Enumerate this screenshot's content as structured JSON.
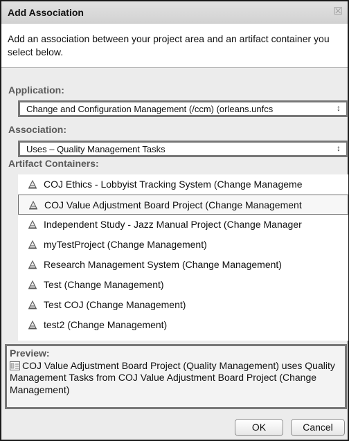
{
  "dialog": {
    "title": "Add Association",
    "close_glyph": "☒",
    "description": "Add an association between your project area and an artifact container you select below."
  },
  "application": {
    "label": "Application:",
    "selected": "Change and Configuration Management (/ccm) (orleans.unfcs"
  },
  "association": {
    "label": "Association:",
    "selected": "Uses – Quality Management Tasks"
  },
  "artifact_containers": {
    "label": "Artifact Containers:",
    "icon": "project-area-icon",
    "items": [
      {
        "label": "COJ Ethics - Lobbyist Tracking System (Change Manageme"
      },
      {
        "label": "COJ Value Adjustment Board Project (Change Management"
      },
      {
        "label": "Independent Study - Jazz Manual Project (Change Manager"
      },
      {
        "label": "myTestProject (Change Management)"
      },
      {
        "label": "Research Management System (Change Management)"
      },
      {
        "label": "Test (Change Management)"
      },
      {
        "label": "Test COJ (Change Management)"
      },
      {
        "label": "test2 (Change Management)"
      }
    ],
    "selected_index": 1
  },
  "preview": {
    "label": "Preview:",
    "text": "COJ Value Adjustment Board Project (Quality Management) uses Quality Management Tasks from COJ Value Adjustment Board Project (Change Management)"
  },
  "buttons": {
    "ok": "OK",
    "cancel": "Cancel"
  },
  "colors": {
    "dialog_border": "#1a1a1a",
    "field_border": "#777777",
    "label_gray": "#5a5a5a",
    "background": "#ececec"
  }
}
